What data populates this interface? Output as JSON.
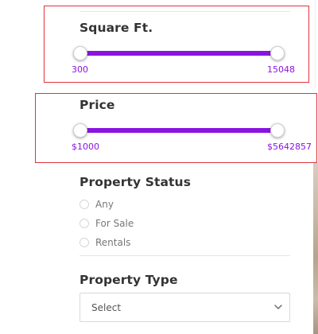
{
  "colors": {
    "accent": "#8a14e0",
    "track_background": "#e4d4f5",
    "highlight_border": "#e0343d"
  },
  "square_ft": {
    "title": "Square Ft.",
    "min_label": "300",
    "max_label": "15048",
    "selected_fraction_low": 0.0,
    "selected_fraction_high": 1.0
  },
  "price": {
    "title": "Price",
    "min_label": "$1000",
    "max_label": "$5642857",
    "selected_fraction_low": 0.0,
    "selected_fraction_high": 1.0
  },
  "property_status": {
    "title": "Property Status",
    "options": [
      "Any",
      "For Sale",
      "Rentals"
    ],
    "selected": null
  },
  "property_type": {
    "title": "Property Type",
    "select_value": "Select",
    "icon": "chevron-down-icon"
  }
}
